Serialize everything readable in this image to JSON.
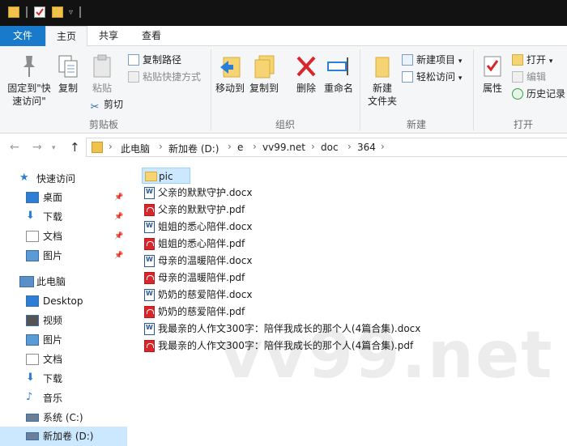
{
  "ribbon_tabs": [
    "文件",
    "主页",
    "共享",
    "查看"
  ],
  "clipboard": {
    "pin_label_1": "固定到\"快",
    "pin_label_2": "速访问\"",
    "copy": "复制",
    "paste": "粘贴",
    "copy_path": "复制路径",
    "paste_shortcut": "粘贴快捷方式",
    "cut": "剪切",
    "group": "剪贴板"
  },
  "organize": {
    "move_to": "移动到",
    "copy_to": "复制到",
    "delete": "删除",
    "rename": "重命名",
    "group": "组织"
  },
  "new": {
    "new_folder_1": "新建",
    "new_folder_2": "文件夹",
    "new_item": "新建项目",
    "easy_access": "轻松访问",
    "group": "新建"
  },
  "open": {
    "properties": "属性",
    "open": "打开",
    "edit": "编辑",
    "history": "历史记录",
    "group": "打开"
  },
  "breadcrumb": [
    "此电脑",
    "新加卷 (D:)",
    "e",
    "vv99.net",
    "doc",
    "364"
  ],
  "nav_pane": [
    {
      "label": "快速访问",
      "icon": "star-icon",
      "pinned": false,
      "indent": 1
    },
    {
      "label": "桌面",
      "icon": "desktop-icon",
      "pinned": true,
      "indent": 2
    },
    {
      "label": "下载",
      "icon": "download-icon",
      "pinned": true,
      "indent": 2
    },
    {
      "label": "文档",
      "icon": "documents-icon",
      "pinned": true,
      "indent": 2
    },
    {
      "label": "图片",
      "icon": "pictures-icon",
      "pinned": true,
      "indent": 2
    },
    {
      "label": "此电脑",
      "icon": "computer-icon",
      "pinned": false,
      "indent": 1
    },
    {
      "label": "Desktop",
      "icon": "desktop-icon",
      "pinned": false,
      "indent": 2
    },
    {
      "label": "视频",
      "icon": "videos-icon",
      "pinned": false,
      "indent": 2
    },
    {
      "label": "图片",
      "icon": "pictures-icon",
      "pinned": false,
      "indent": 2
    },
    {
      "label": "文档",
      "icon": "documents-icon",
      "pinned": false,
      "indent": 2
    },
    {
      "label": "下载",
      "icon": "download-icon",
      "pinned": false,
      "indent": 2
    },
    {
      "label": "音乐",
      "icon": "music-icon",
      "pinned": false,
      "indent": 2
    },
    {
      "label": "系统 (C:)",
      "icon": "drive-icon",
      "pinned": false,
      "indent": 2
    },
    {
      "label": "新加卷 (D:)",
      "icon": "drive-icon",
      "pinned": false,
      "indent": 2
    }
  ],
  "files": [
    {
      "name": "pic",
      "type": "folder"
    },
    {
      "name": "父亲的默默守护.docx",
      "type": "docx"
    },
    {
      "name": "父亲的默默守护.pdf",
      "type": "pdf"
    },
    {
      "name": "姐姐的悉心陪伴.docx",
      "type": "docx"
    },
    {
      "name": "姐姐的悉心陪伴.pdf",
      "type": "pdf"
    },
    {
      "name": "母亲的温暖陪伴.docx",
      "type": "docx"
    },
    {
      "name": "母亲的温暖陪伴.pdf",
      "type": "pdf"
    },
    {
      "name": "奶奶的慈爱陪伴.docx",
      "type": "docx"
    },
    {
      "name": "奶奶的慈爱陪伴.pdf",
      "type": "pdf"
    },
    {
      "name": "我最亲的人作文300字：陪伴我成长的那个人(4篇合集).docx",
      "type": "docx"
    },
    {
      "name": "我最亲的人作文300字：陪伴我成长的那个人(4篇合集).pdf",
      "type": "pdf"
    }
  ],
  "watermark": "vv99.net",
  "colors": {
    "file_tab": "#1979ca",
    "selection": "#cce8ff",
    "folder": "#f6d473",
    "pdf": "#d9262b",
    "docx": "#2b579a"
  }
}
